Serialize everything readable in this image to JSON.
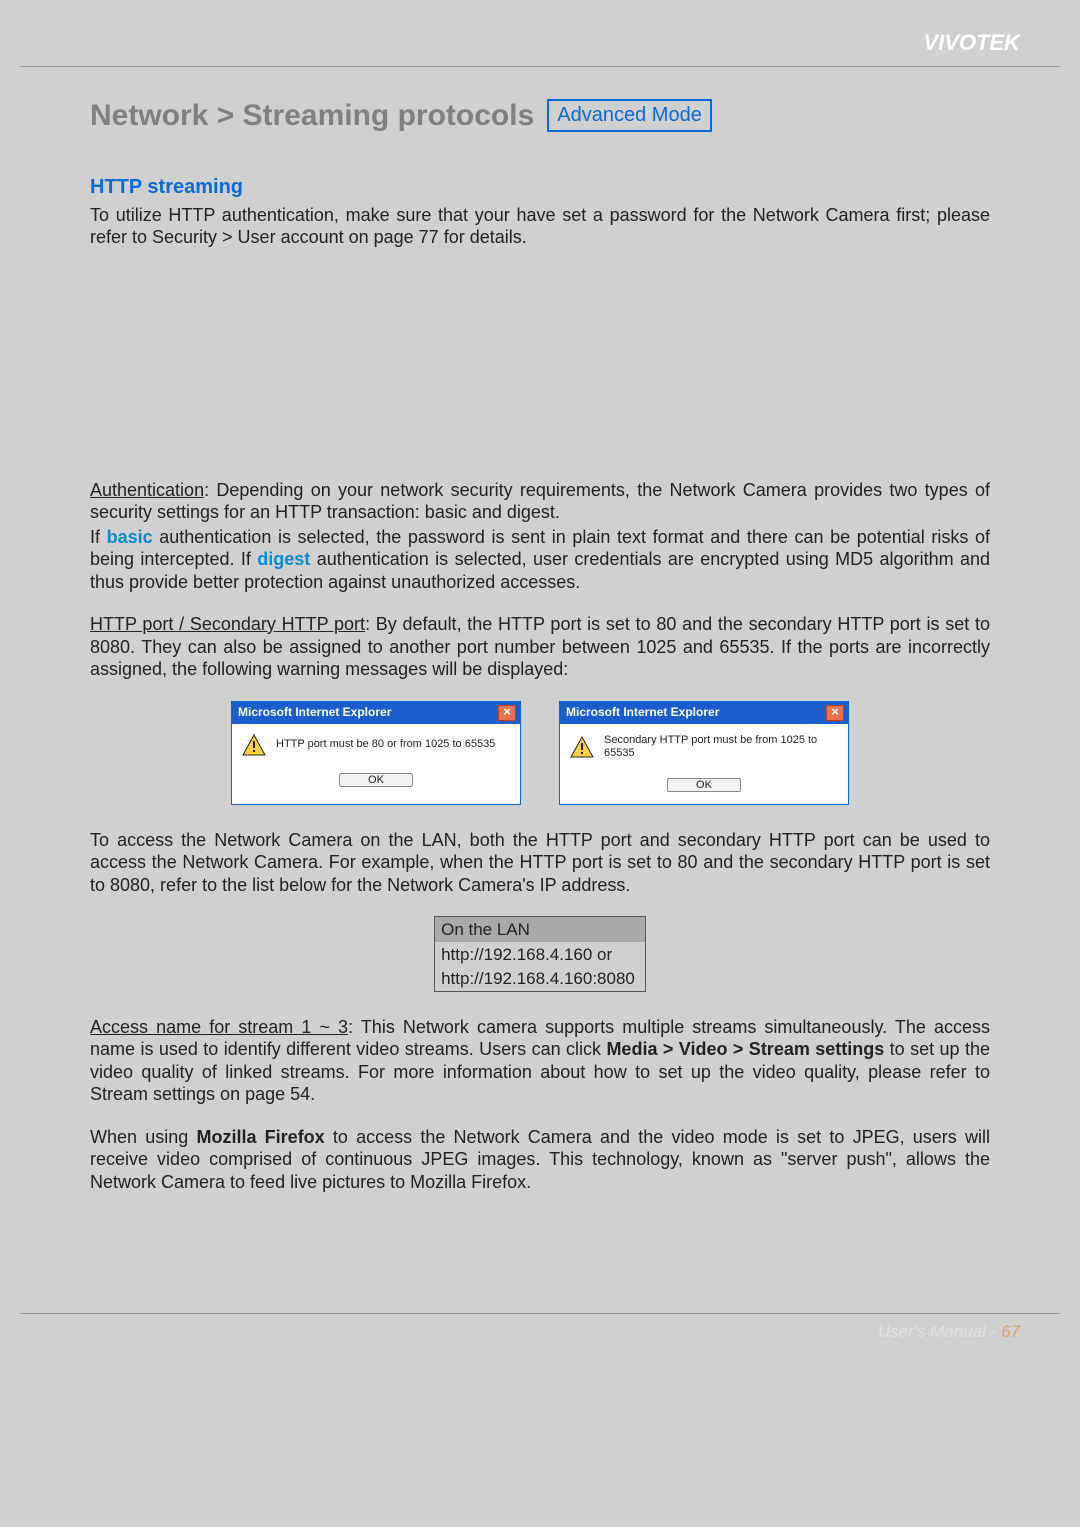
{
  "brand": "VIVOTEK",
  "title": "Network > Streaming protocols",
  "mode_badge": "Advanced Mode",
  "section_heading": "HTTP streaming",
  "intro_para": "To utilize HTTP authentication, make sure that your have set a password for the Network Camera first; please refer to Security > User account on page 77 for details.",
  "auth_label": "Authentication",
  "auth_text": ": Depending on your network security requirements, the Network Camera provides two types of security settings for an HTTP transaction: basic and digest.",
  "basic_pre": "If ",
  "basic_word": "basic",
  "basic_post": " authentication is selected, the password is sent in plain text format and there can be potential risks of being intercepted. If ",
  "digest_word": "digest",
  "digest_post": " authentication is selected, user credentials are encrypted using MD5 algorithm and thus provide better protection against unauthorized accesses.",
  "port_label": "HTTP port / Secondary HTTP port",
  "port_text": ": By default, the HTTP port is set to 80 and the secondary HTTP port is set to 8080. They can also be assigned to another port number between 1025 and 65535. If the ports are incorrectly assigned, the following warning messages will be displayed:",
  "dialogs": [
    {
      "title": "Microsoft Internet Explorer",
      "msg": "HTTP port must be 80 or from 1025 to 65535",
      "ok": "OK",
      "close": "×"
    },
    {
      "title": "Microsoft Internet Explorer",
      "msg": "Secondary HTTP port must be from 1025 to 65535",
      "ok": "OK",
      "close": "×"
    }
  ],
  "lan_intro": "To access the Network Camera on the LAN, both the HTTP port and secondary HTTP port can be used to access the Network Camera. For example, when the HTTP port is set to 80 and the secondary HTTP port is set to 8080, refer to the list below for the Network Camera's IP address.",
  "lan_table": {
    "header": "On the LAN",
    "line1": "http://192.168.4.160  or",
    "line2": "http://192.168.4.160:8080"
  },
  "access_label": "Access name for stream 1 ~ 3",
  "access_text_1": ": This Network camera supports multiple streams simultaneously. The access name is used to identify different video streams. Users can click ",
  "access_bold": "Media > Video > Stream settings",
  "access_text_2": " to set up the video quality of linked streams. For more information about how to set up the video quality, please refer to Stream settings on page 54.",
  "firefox_pre": "When using ",
  "firefox_bold": "Mozilla Firefox",
  "firefox_post": " to access the Network Camera and the video mode is set to JPEG, users will receive video comprised of continuous JPEG images. This technology, known as \"server push\", allows the Network Camera to feed live pictures to Mozilla Firefox.",
  "footer_label": "User's Manual - ",
  "footer_page": "67"
}
